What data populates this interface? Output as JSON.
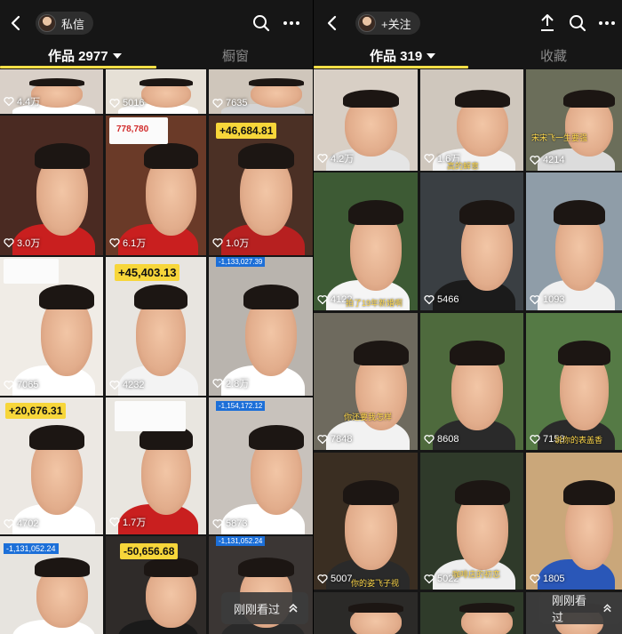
{
  "left": {
    "chip_label": "私信",
    "tab_works": "作品 2977",
    "tab_showcase": "橱窗",
    "seen_label": "刚刚看过",
    "cells": [
      {
        "likes": "4.4万"
      },
      {
        "likes": "5016"
      },
      {
        "likes": "7635"
      },
      {
        "likes": "3.0万"
      },
      {
        "likes": "6.1万"
      },
      {
        "likes": "1.0万"
      },
      {
        "likes": "7065"
      },
      {
        "likes": "4232"
      },
      {
        "likes": "2.8万"
      },
      {
        "likes": "4702"
      },
      {
        "likes": "1.7万"
      },
      {
        "likes": "5873"
      },
      {
        "likes": ""
      },
      {
        "likes": ""
      },
      {
        "likes": ""
      }
    ],
    "overlays": {
      "r1c2_top": "778,780",
      "r1c3_badge": "+46,684.81",
      "r2c2_badge": "+45,403.13",
      "r2c3_badge": "-1,133,027.39",
      "r3c1_badge": "+20,676.31",
      "r3c3_badge": "-1,154,172.12",
      "r4c1_badge": "-1,131,052.24",
      "r4c2_badge": "-50,656.68",
      "r4c3_badge": "-1,131,052.24"
    }
  },
  "right": {
    "chip_label": "+关注",
    "tab_works": "作品 319",
    "tab_favorites": "收藏",
    "seen_label": "刚刚看过",
    "cells": [
      {
        "likes": "4.2万"
      },
      {
        "likes": "1.6万"
      },
      {
        "likes": "4214"
      },
      {
        "likes": "4122"
      },
      {
        "likes": "5466"
      },
      {
        "likes": "1093"
      },
      {
        "likes": "7848"
      },
      {
        "likes": "8608"
      },
      {
        "likes": "7153"
      },
      {
        "likes": "5007"
      },
      {
        "likes": "5022"
      },
      {
        "likes": "1805"
      },
      {
        "likes": ""
      },
      {
        "likes": ""
      },
      {
        "likes": ""
      }
    ],
    "captions": {
      "r0c1": "高的解意",
      "r0c2": "宋宋飞一生要强",
      "r1c0": "拍了19年新婚啊",
      "r2c0": "你还要我怎样",
      "r2c2": "说你的表盖香",
      "r3c0": "你的姿飞子视",
      "r3c1": "咖啡店的初恋"
    }
  }
}
